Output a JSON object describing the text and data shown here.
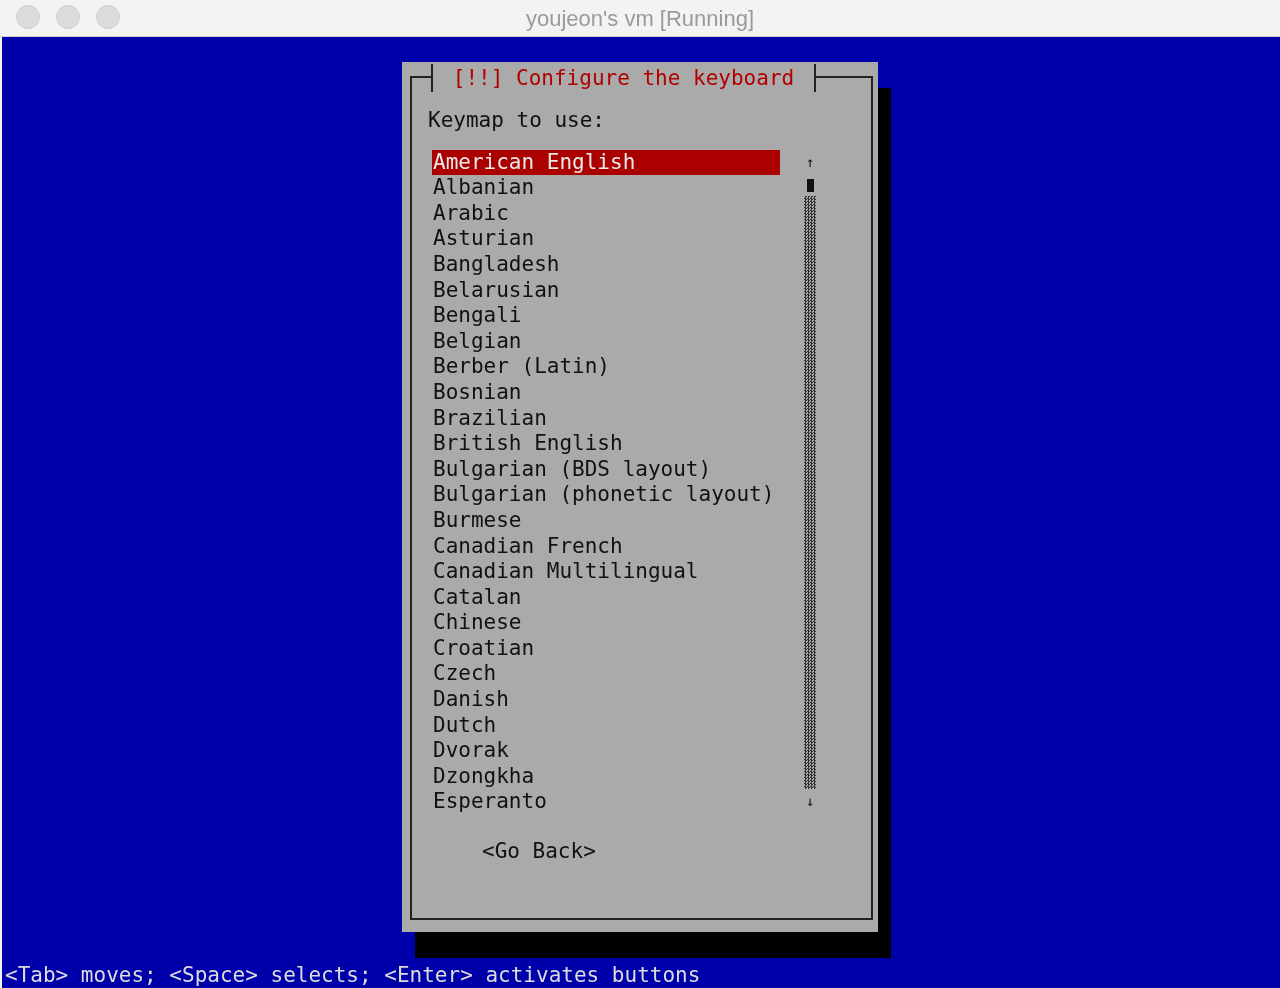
{
  "window": {
    "title": "youjeon's vm [Running]"
  },
  "dialog": {
    "title": "[!!] Configure the keyboard",
    "prompt": "Keymap to use:",
    "scroll_up": "↑",
    "scroll_down": "↓",
    "items": [
      {
        "label": "American English",
        "selected": true
      },
      {
        "label": "Albanian",
        "selected": false
      },
      {
        "label": "Arabic",
        "selected": false
      },
      {
        "label": "Asturian",
        "selected": false
      },
      {
        "label": "Bangladesh",
        "selected": false
      },
      {
        "label": "Belarusian",
        "selected": false
      },
      {
        "label": "Bengali",
        "selected": false
      },
      {
        "label": "Belgian",
        "selected": false
      },
      {
        "label": "Berber (Latin)",
        "selected": false
      },
      {
        "label": "Bosnian",
        "selected": false
      },
      {
        "label": "Brazilian",
        "selected": false
      },
      {
        "label": "British English",
        "selected": false
      },
      {
        "label": "Bulgarian (BDS layout)",
        "selected": false
      },
      {
        "label": "Bulgarian (phonetic layout)",
        "selected": false
      },
      {
        "label": "Burmese",
        "selected": false
      },
      {
        "label": "Canadian French",
        "selected": false
      },
      {
        "label": "Canadian Multilingual",
        "selected": false
      },
      {
        "label": "Catalan",
        "selected": false
      },
      {
        "label": "Chinese",
        "selected": false
      },
      {
        "label": "Croatian",
        "selected": false
      },
      {
        "label": "Czech",
        "selected": false
      },
      {
        "label": "Danish",
        "selected": false
      },
      {
        "label": "Dutch",
        "selected": false
      },
      {
        "label": "Dvorak",
        "selected": false
      },
      {
        "label": "Dzongkha",
        "selected": false
      },
      {
        "label": "Esperanto",
        "selected": false
      }
    ],
    "button": "<Go Back>"
  },
  "status_bar": "<Tab> moves; <Space> selects; <Enter> activates buttons"
}
